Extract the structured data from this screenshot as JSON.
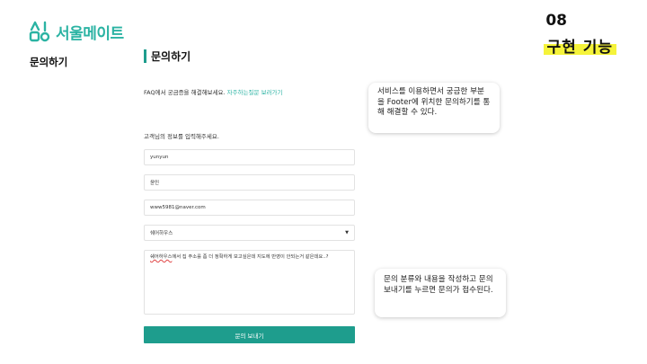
{
  "logo": {
    "text": "서울메이트",
    "brand_color": "#2bb3a3"
  },
  "sidebar": {
    "label": "문의하기"
  },
  "slide": {
    "number": "08",
    "title": "구현 기능",
    "highlight_color": "#f5f33a"
  },
  "page": {
    "title": "문의하기"
  },
  "faq": {
    "text": "FAQ에서 궁금증을 해결해보세요.",
    "link": "자주하는질문 보러가기"
  },
  "form": {
    "intro": "고객님의 정보를 입력해주세요.",
    "name_value": "yunyun",
    "name2_value": "윤민",
    "email_value": "www5981@naver.com",
    "category_value": "쉐어하우스",
    "message_part1": "쉐어하우스",
    "message_part2": "에서 집 주소를 좀 더 정확하게 보고싶은데 지도에 반영이 안되는거 같은데요..?",
    "submit_label": "문의 보내기",
    "accent_color": "#1e9d8d"
  },
  "notes": {
    "top": "서비스를 이용하면서 궁금한 부분을 Footer에 위치한 문의하기를 통해 해결할 수 있다.",
    "bottom": "문의 분류와 내용을 작성하고 문의 보내기를 누르면 문의가 접수된다."
  }
}
